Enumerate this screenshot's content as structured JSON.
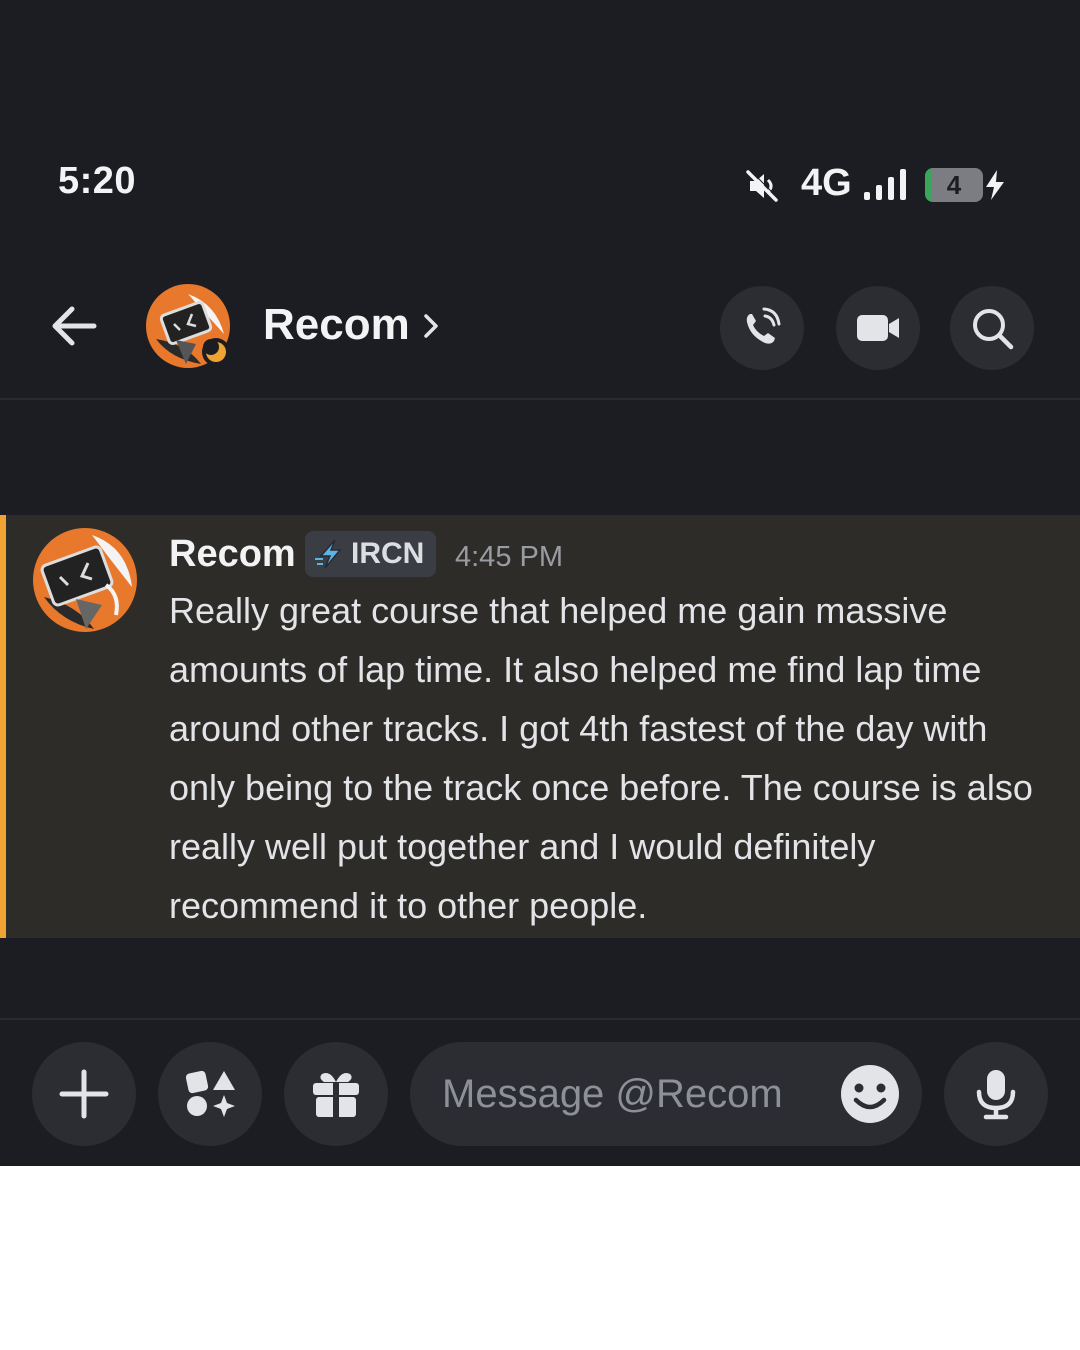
{
  "status_bar": {
    "time": "5:20",
    "network": "4G",
    "battery_level": "4",
    "battery_fraction": 0.04,
    "icons": [
      "mute-icon",
      "signal-icon",
      "battery-icon",
      "charging-bolt-icon"
    ]
  },
  "header": {
    "title": "Recom",
    "icons": [
      "back-arrow-icon",
      "chevron-right-icon",
      "phone-call-icon",
      "video-camera-icon",
      "search-icon"
    ]
  },
  "message": {
    "author": "Recom",
    "clan_tag": "IRCN",
    "timestamp": "4:45 PM",
    "text": "Really great course that helped me gain massive amounts of lap time. It also helped me find lap time around other tracks. I got 4th fastest of the day with only being to the track once before. The course is also really well put together and I would definitely recommend it to other people."
  },
  "composer": {
    "placeholder": "Message @Recom",
    "icons": [
      "plus-icon",
      "apps-icon",
      "gift-icon",
      "emoji-icon",
      "microphone-icon"
    ]
  },
  "colors": {
    "app_background": "#1c1d22",
    "highlight_background": "#2e2c29",
    "highlight_bar": "#f0a232",
    "button_background": "#2b2d33",
    "text_primary": "#f2f3f5",
    "battery_fill": "#3ba55c"
  }
}
